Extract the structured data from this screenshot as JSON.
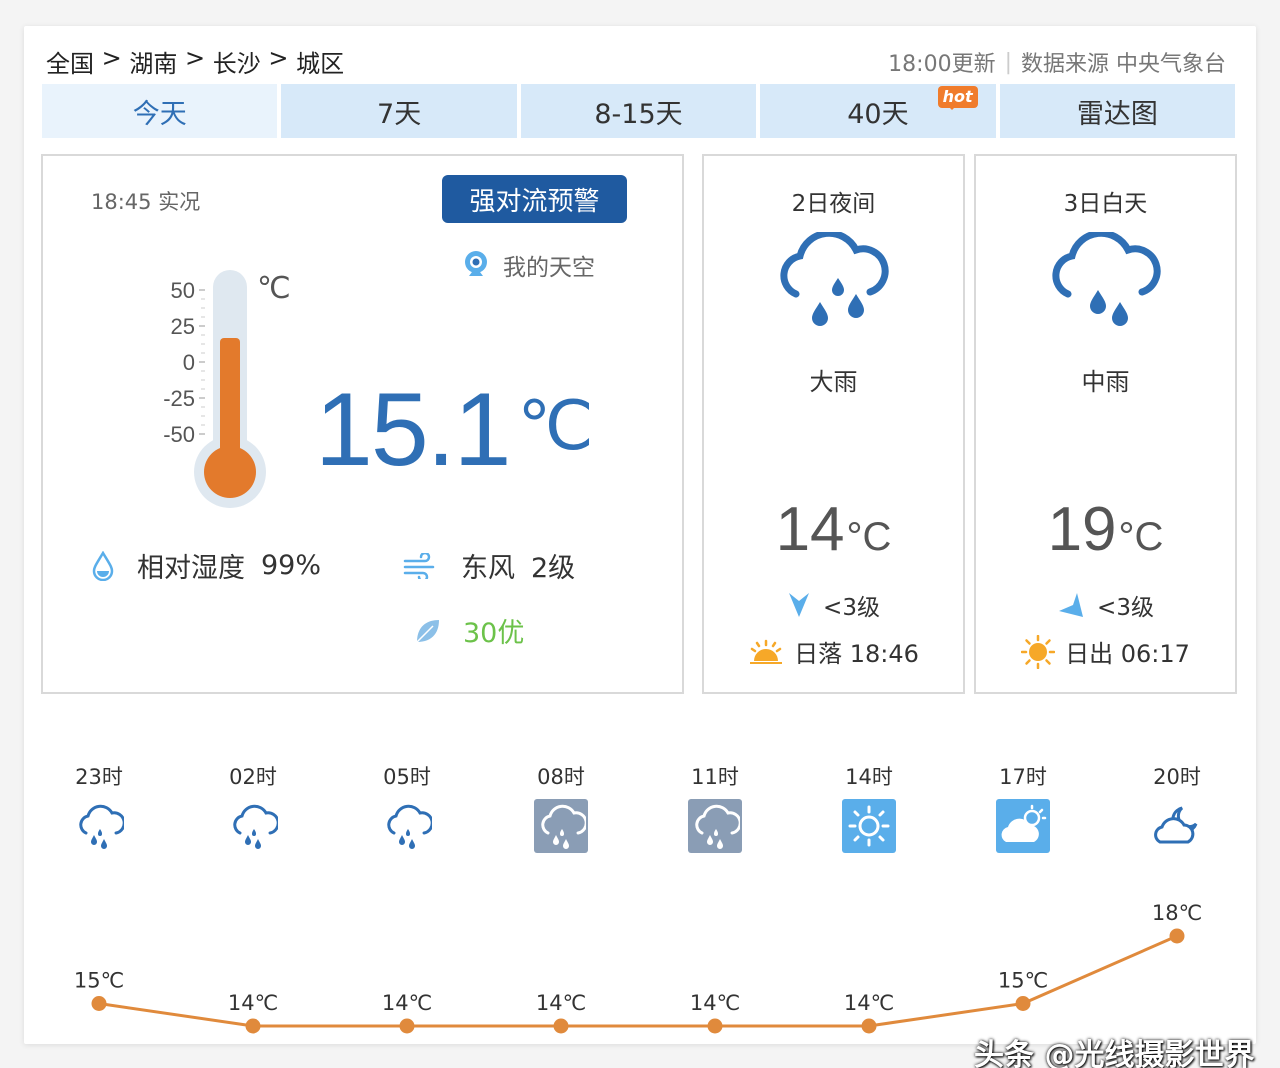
{
  "breadcrumb": [
    "全国",
    " > ",
    "湖南",
    " > ",
    "长沙",
    " > ",
    "城区"
  ],
  "update": {
    "time": "18:00更新",
    "source": "数据来源 中央气象台"
  },
  "tabs": [
    {
      "label": "今天",
      "active": true
    },
    {
      "label": "7天"
    },
    {
      "label": "8-15天"
    },
    {
      "label": "40天",
      "badge": "hot"
    },
    {
      "label": "雷达图"
    }
  ],
  "now": {
    "obs_time": "18:45 实况",
    "alert": "强对流预警",
    "my_sky": "我的天空",
    "thermo_unit": "℃",
    "thermo_ticks": [
      "50",
      "25",
      "0",
      "-25",
      "-50"
    ],
    "temp": "15.1",
    "temp_unit": "℃",
    "humidity_label": "相对湿度",
    "humidity_value": "99%",
    "wind_dir": "东风",
    "wind_level": "2级",
    "aqi": "30优"
  },
  "forecast": [
    {
      "title": "2日夜间",
      "desc": "大雨",
      "temp": "14",
      "unit": "°C",
      "wind": "<3级",
      "sun_label": "日落 18:46",
      "icon": "heavy-rain-icon"
    },
    {
      "title": "3日白天",
      "desc": "中雨",
      "temp": "19",
      "unit": "°C",
      "wind": "<3级",
      "sun_label": "日出 06:17",
      "icon": "moderate-rain-icon"
    }
  ],
  "hourly": {
    "hours": [
      "23时",
      "02时",
      "05时",
      "08时",
      "11时",
      "14时",
      "17时",
      "20时"
    ],
    "icons": [
      "rain-icon",
      "rain-icon",
      "rain-icon",
      "rain-icon",
      "rain-icon",
      "sunny-icon",
      "partly-cloudy-icon",
      "cloudy-night-icon"
    ],
    "temps": [
      15,
      14,
      14,
      14,
      14,
      14,
      15,
      18
    ],
    "temp_labels": [
      "15℃",
      "14℃",
      "14℃",
      "14℃",
      "14℃",
      "14℃",
      "15℃",
      "18℃"
    ]
  },
  "watermark": "头条 @光线摄影世界",
  "colors": {
    "accent": "#2f6fb5",
    "tab_bg": "#d7e9f9",
    "alert": "#1f5aa0",
    "curve": "#e08a3c",
    "aqi": "#6cc24a"
  }
}
